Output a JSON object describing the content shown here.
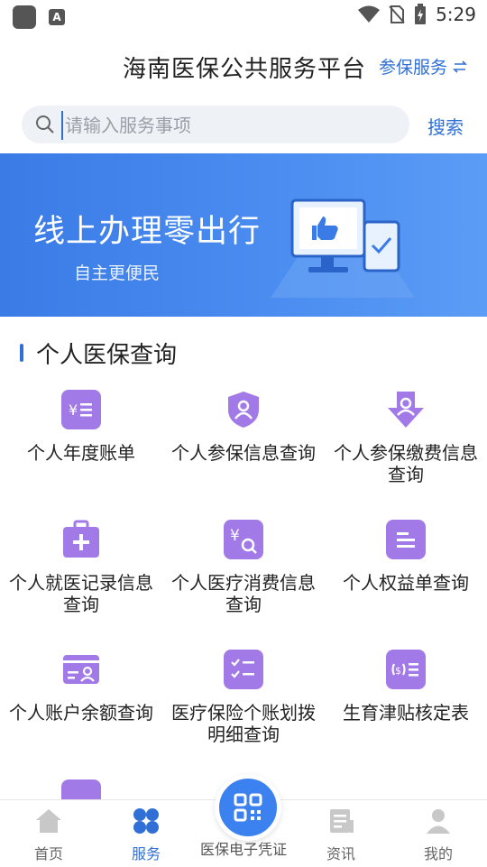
{
  "status_bar": {
    "time": "5:29"
  },
  "header": {
    "title": "海南医保公共服务平台",
    "service_link": "参保服务"
  },
  "search": {
    "placeholder": "请输入服务事项",
    "button": "搜索"
  },
  "banner": {
    "title": "线上办理零出行",
    "subtitle": "自主更便民"
  },
  "section": {
    "title": "个人医保查询"
  },
  "tiles": [
    {
      "label": "个人年度账单",
      "icon": "bill-icon"
    },
    {
      "label": "个人参保信息查询",
      "icon": "shield-person-icon"
    },
    {
      "label": "个人参保缴费信息查询",
      "icon": "payment-download-icon"
    },
    {
      "label": "个人就医记录信息查询",
      "icon": "medical-kit-icon"
    },
    {
      "label": "个人医疗消费信息查询",
      "icon": "yuan-search-icon"
    },
    {
      "label": "个人权益单查询",
      "icon": "document-icon"
    },
    {
      "label": "个人账户余额查询",
      "icon": "account-card-icon"
    },
    {
      "label": "医疗保险个账划拨明细查询",
      "icon": "checklist-icon"
    },
    {
      "label": "生育津贴核定表",
      "icon": "allowance-icon"
    }
  ],
  "tabbar": {
    "home": "首页",
    "service": "服务",
    "center": "医保电子凭证",
    "news": "资讯",
    "mine": "我的"
  },
  "colors": {
    "accent": "#2f6fd6",
    "tile_icon": "#a27ae8",
    "banner": "#4a8cf0"
  }
}
